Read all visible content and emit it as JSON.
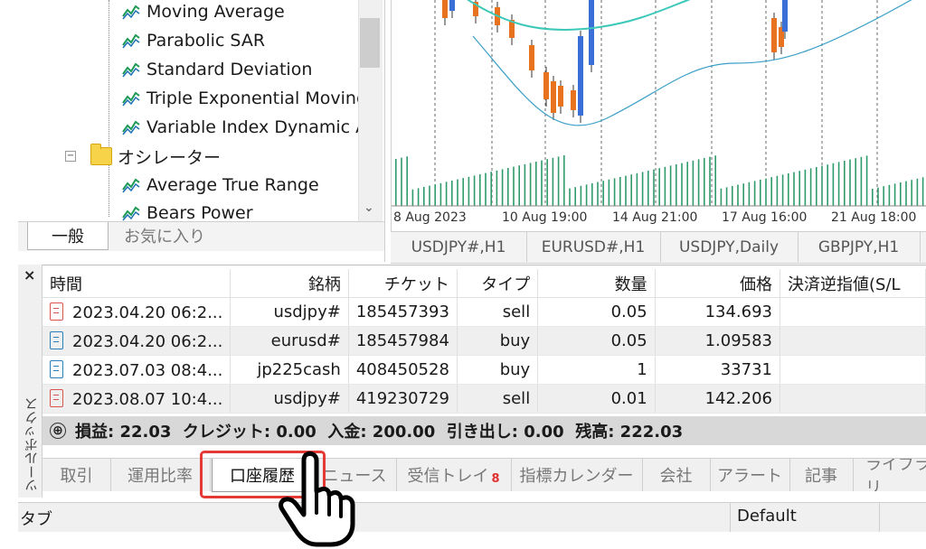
{
  "navigator": {
    "indicators": [
      {
        "label": "Moving Average",
        "icon": "indicator-icon"
      },
      {
        "label": "Parabolic SAR",
        "icon": "indicator-icon"
      },
      {
        "label": "Standard Deviation",
        "icon": "indicator-icon"
      },
      {
        "label": "Triple Exponential Moving",
        "icon": "indicator-icon"
      },
      {
        "label": "Variable Index Dynamic Av",
        "icon": "indicator-icon"
      }
    ],
    "folder": {
      "label": "オシレーター",
      "icon": "folder-icon",
      "collapse": "−"
    },
    "oscillators": [
      {
        "label": "Average True Range",
        "icon": "indicator-icon"
      },
      {
        "label": "Bears Power",
        "icon": "indicator-icon"
      }
    ],
    "tabs": [
      {
        "label": "一般",
        "active": true
      },
      {
        "label": "お気に入り",
        "active": false
      }
    ]
  },
  "chart": {
    "date_labels": [
      "8 Aug 2023",
      "10 Aug 19:00",
      "14 Aug 21:00",
      "17 Aug 16:00",
      "21 Aug 18:00"
    ],
    "colors": {
      "up": "#3a6fd8",
      "down": "#e8731e",
      "band_upper": "#3cc8b8",
      "band_lower": "#3ca0c8",
      "volume": "#2f9a6a"
    }
  },
  "chart_tabs": [
    "USDJPY#,H1",
    "EURUSD#,H1",
    "USDJPY,Daily",
    "GBPJPY,H1"
  ],
  "toolbox": {
    "close_icon": "×",
    "vertical_label": "ツールボックス",
    "columns": [
      "時間",
      "銘柄",
      "チケット",
      "タイプ",
      "数量",
      "価格",
      "決済逆指値(S/L"
    ],
    "rows": [
      {
        "time": "2023.04.20 06:2...",
        "symbol": "usdjpy#",
        "ticket": "185457393",
        "type": "sell",
        "volume": "0.05",
        "price": "134.693",
        "sl": ""
      },
      {
        "time": "2023.04.20 06:2...",
        "symbol": "eurusd#",
        "ticket": "185457984",
        "type": "buy",
        "volume": "0.05",
        "price": "1.09583",
        "sl": ""
      },
      {
        "time": "2023.07.03 08:4...",
        "symbol": "jp225cash",
        "ticket": "408450528",
        "type": "buy",
        "volume": "1",
        "price": "33731",
        "sl": ""
      },
      {
        "time": "2023.08.07 10:4...",
        "symbol": "usdjpy#",
        "ticket": "419230729",
        "type": "sell",
        "volume": "0.01",
        "price": "142.206",
        "sl": ""
      }
    ],
    "summary": "損益: 22.03  クレジット: 0.00  入金: 200.00  引き出し: 0.00  残高: 222.03",
    "summary_icon": "⊕",
    "tabs": [
      {
        "label": "取引"
      },
      {
        "label": "運用比率"
      },
      {
        "label": "口座履歴",
        "active": true
      },
      {
        "label": "ニュース"
      },
      {
        "label": "受信トレイ",
        "badge": "8"
      },
      {
        "label": "指標カレンダー"
      },
      {
        "label": "会社"
      },
      {
        "label": "アラート"
      },
      {
        "label": "記事"
      },
      {
        "label": "ライブラリ"
      }
    ]
  },
  "status": {
    "left": "タブ",
    "right": "Default"
  },
  "accent": {
    "highlight": "#e53935"
  }
}
